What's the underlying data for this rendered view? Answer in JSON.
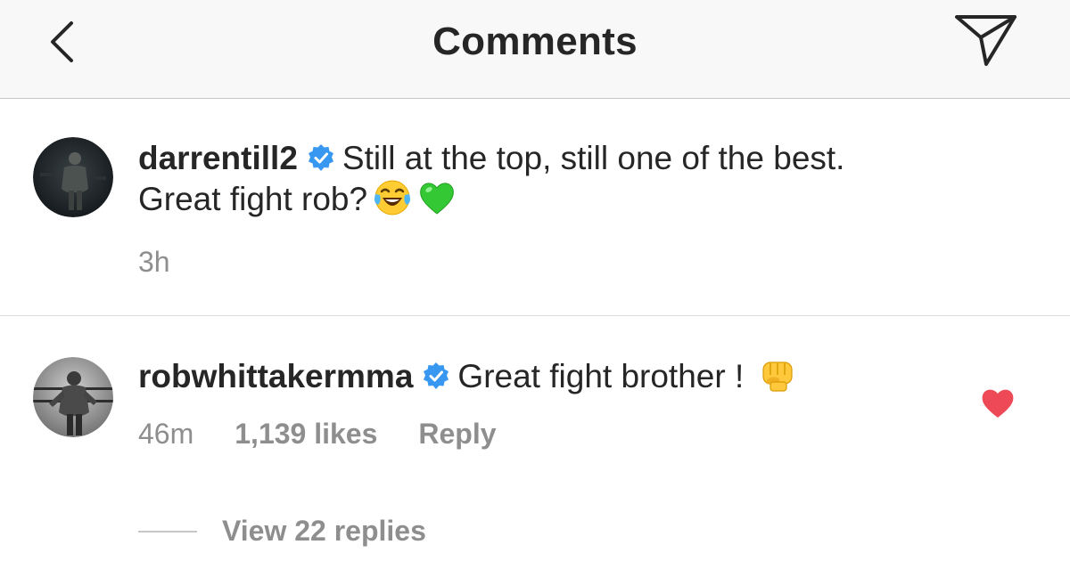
{
  "header": {
    "title": "Comments",
    "back_icon": "chevron-left-icon",
    "send_icon": "paper-plane-icon"
  },
  "comments": [
    {
      "username": "darrentill2",
      "verified": true,
      "text_line1": "Still at the top, still one of the best.",
      "text_line2": "Great fight rob?",
      "emojis": [
        "face-with-tears-of-joy",
        "green-heart"
      ],
      "time": "3h"
    },
    {
      "username": "robwhittakermma",
      "verified": true,
      "text": "Great fight brother !",
      "emojis": [
        "oncoming-fist"
      ],
      "time": "46m",
      "likes": "1,139 likes",
      "reply_label": "Reply",
      "liked": true,
      "view_replies": "View 22 replies"
    }
  ],
  "colors": {
    "header_bg": "#f8f8f8",
    "text": "#262626",
    "meta": "#8e8e8e",
    "verified": "#3897f0",
    "like": "#ed4956"
  }
}
